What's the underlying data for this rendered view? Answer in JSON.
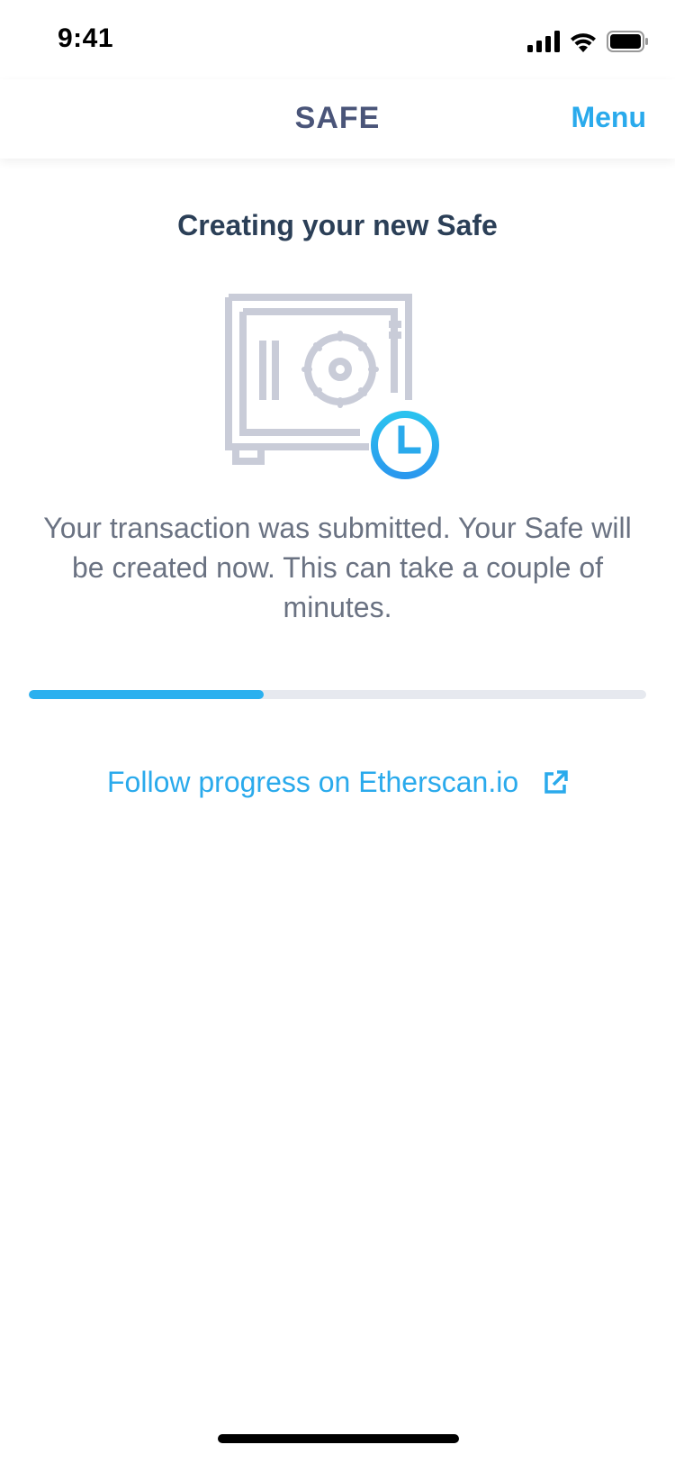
{
  "status_bar": {
    "time": "9:41",
    "icons": [
      "signal-icon",
      "wifi-icon",
      "battery-icon"
    ]
  },
  "nav": {
    "title": "SAFE",
    "menu_label": "Menu"
  },
  "content": {
    "heading": "Creating your new Safe",
    "illustration_icon": "safe-with-clock-icon",
    "description": "Your transaction was submitted. Your Safe will be created now. This can take a couple of minutes.",
    "progress_fraction": 0.38,
    "link_text": "Follow progress on Etherscan.io",
    "link_icon": "external-link-icon"
  },
  "colors": {
    "accent": "#2aaaec",
    "nav_title": "#4a5579",
    "heading": "#2b3f57",
    "body_text": "#6a7282",
    "illustration_gray": "#c9ccd8",
    "progress_track": "#e6e9ef"
  }
}
